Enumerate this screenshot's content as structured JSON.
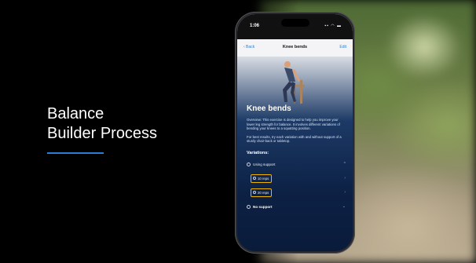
{
  "slide": {
    "heading_line1": "Balance",
    "heading_line2": "Builder Process",
    "accent_color": "#2a7fd4"
  },
  "phone": {
    "status": {
      "time": "1:06",
      "icons": "▪▪ ◠ ▬"
    },
    "nav": {
      "back_label": "‹ Back",
      "title": "Knee bends",
      "edit_label": "Edit"
    },
    "exercise": {
      "title": "Knee bends",
      "overview": "Overview: This exercise is designed to help you improve your lower leg strength for balance. It involves different variations of bending your knees to a squatting position.",
      "tips": "For best results, try each variation with and without support of a sturdy chair-back or tabletop.",
      "variations_heading": "Variations:",
      "variations": [
        {
          "label": "Using support",
          "chevron": "^"
        },
        {
          "label": "10 reps",
          "chevron": "›",
          "highlighted": true
        },
        {
          "label": "20 reps",
          "chevron": "›",
          "highlighted": true
        },
        {
          "label": "No support",
          "chevron": "⌄"
        }
      ],
      "highlight_color": "#f0b400"
    }
  }
}
